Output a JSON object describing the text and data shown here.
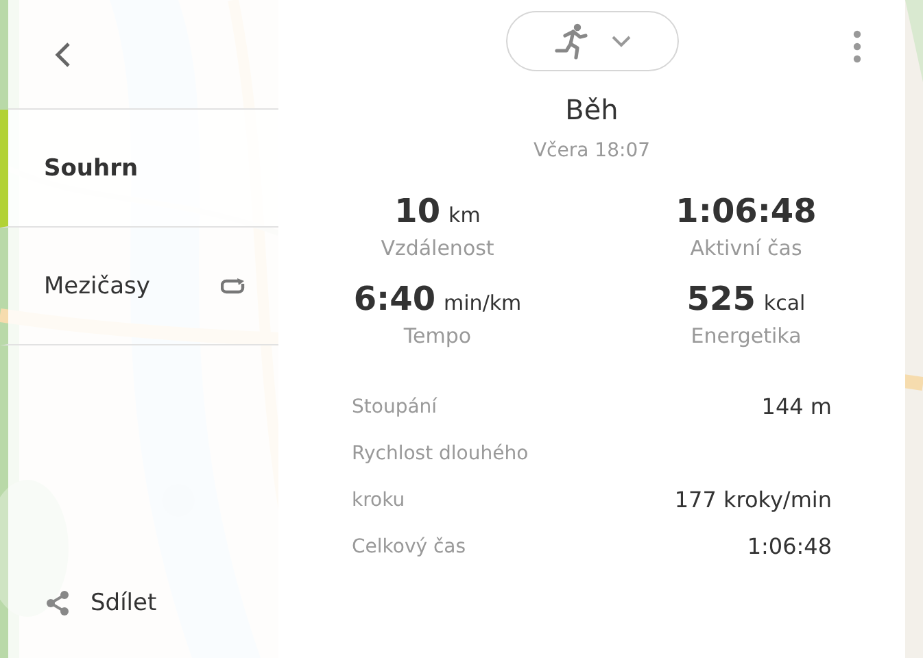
{
  "sidebar": {
    "items": [
      {
        "label": "Souhrn",
        "selected": true,
        "kind": "plain"
      },
      {
        "label": "Mezičasy",
        "selected": false,
        "kind": "with_icon"
      }
    ],
    "share": {
      "label": "Sdílet"
    }
  },
  "activity": {
    "title": "Běh",
    "date": "Včera 18:07"
  },
  "stats": [
    {
      "value": "10",
      "unit": "km",
      "label": "Vzdálenost"
    },
    {
      "value": "1:06:48",
      "label": "Aktivní čas"
    },
    {
      "value": "6:40",
      "unit": "min/km",
      "label": "Tempo"
    },
    {
      "value": "525",
      "unit": "kcal",
      "label": "Energetika"
    }
  ],
  "details": [
    {
      "label": "Stoupání",
      "value": "144 m"
    },
    {
      "label": "Rychlost dlouhého kroku",
      "value": "177 kroky/min"
    },
    {
      "label": "Celkový čas",
      "value": "1:06:48"
    }
  ]
}
